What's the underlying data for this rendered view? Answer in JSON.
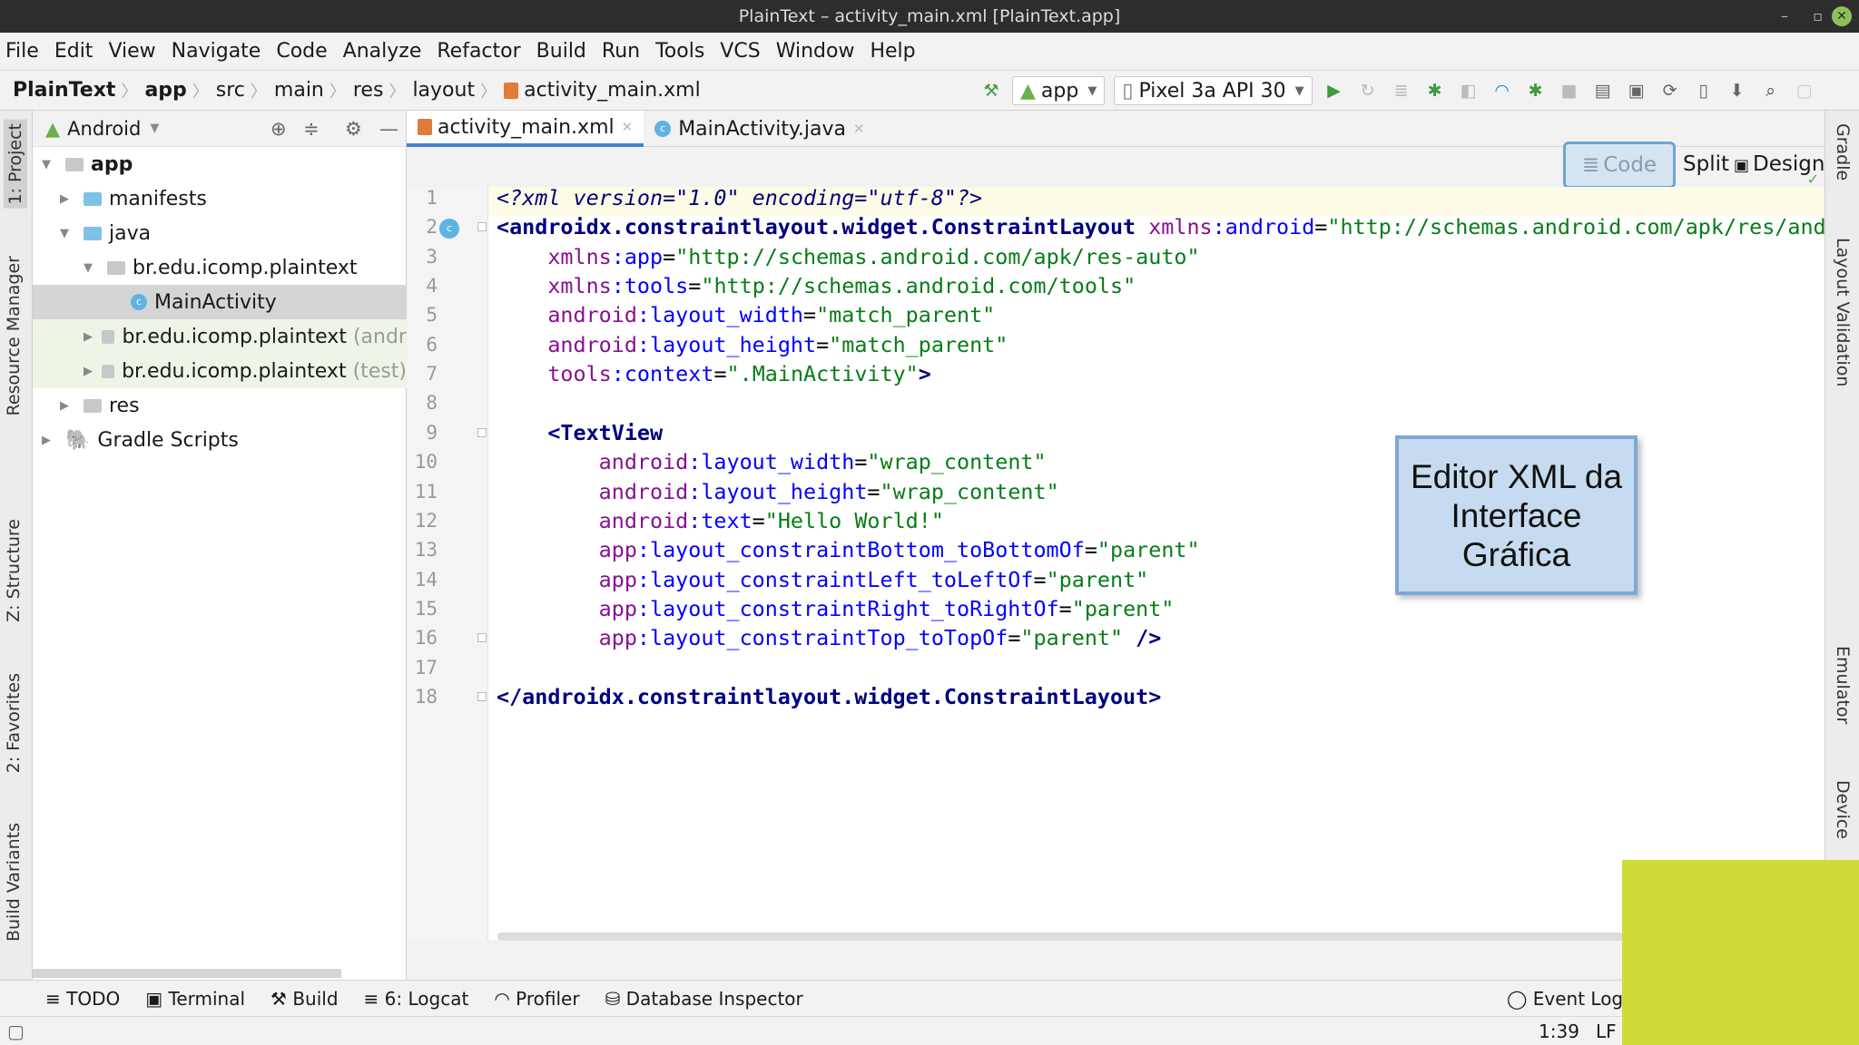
{
  "window": {
    "title": "PlainText – activity_main.xml [PlainText.app]",
    "minimize": "–",
    "maximize": "▫",
    "close": "✕"
  },
  "menu": [
    "File",
    "Edit",
    "View",
    "Navigate",
    "Code",
    "Analyze",
    "Refactor",
    "Build",
    "Run",
    "Tools",
    "VCS",
    "Window",
    "Help"
  ],
  "breadcrumb": [
    "PlainText",
    "app",
    "src",
    "main",
    "res",
    "layout",
    "activity_main.xml"
  ],
  "toolbar": {
    "run_config": "app",
    "device": "Pixel 3a API 30"
  },
  "left_stripe": [
    "1: Project",
    "Resource Manager",
    "Z: Structure",
    "2: Favorites",
    "Build Variants"
  ],
  "project": {
    "view_mode": "Android",
    "tree": [
      {
        "label": "app"
      },
      {
        "label": "manifests"
      },
      {
        "label": "java"
      },
      {
        "label": "br.edu.icomp.plaintext"
      },
      {
        "label": "MainActivity"
      },
      {
        "label": "br.edu.icomp.plaintext",
        "suffix": "(andr"
      },
      {
        "label": "br.edu.icomp.plaintext",
        "suffix": "(test)"
      },
      {
        "label": "res"
      },
      {
        "label": "Gradle Scripts"
      }
    ]
  },
  "tabs": [
    {
      "label": "activity_main.xml"
    },
    {
      "label": "MainActivity.java"
    }
  ],
  "view_modes": {
    "code": "Code",
    "split": "Split",
    "design": "Design"
  },
  "code_lines": [
    [
      [
        "pi",
        "<?xml version=\"1.0\" encoding=\"utf-8\"?>"
      ]
    ],
    [
      [
        "tag",
        "<androidx.constraintlayout.widget.ConstraintLayout "
      ],
      [
        "ns",
        "xmlns"
      ],
      [
        "attr",
        ":android"
      ],
      [
        "pun",
        "="
      ],
      [
        "val",
        "\"http://schemas.android.com/apk/res/and"
      ]
    ],
    [
      [
        "pun",
        "    "
      ],
      [
        "ns",
        "xmlns"
      ],
      [
        "attr",
        ":app"
      ],
      [
        "pun",
        "="
      ],
      [
        "val",
        "\"http://schemas.android.com/apk/res-auto\""
      ]
    ],
    [
      [
        "pun",
        "    "
      ],
      [
        "ns",
        "xmlns"
      ],
      [
        "attr",
        ":tools"
      ],
      [
        "pun",
        "="
      ],
      [
        "val",
        "\"http://schemas.android.com/tools\""
      ]
    ],
    [
      [
        "pun",
        "    "
      ],
      [
        "ns",
        "android"
      ],
      [
        "attr",
        ":layout_width"
      ],
      [
        "pun",
        "="
      ],
      [
        "val",
        "\"match_parent\""
      ]
    ],
    [
      [
        "pun",
        "    "
      ],
      [
        "ns",
        "android"
      ],
      [
        "attr",
        ":layout_height"
      ],
      [
        "pun",
        "="
      ],
      [
        "val",
        "\"match_parent\""
      ]
    ],
    [
      [
        "pun",
        "    "
      ],
      [
        "ns",
        "tools"
      ],
      [
        "attr",
        ":context"
      ],
      [
        "pun",
        "="
      ],
      [
        "val",
        "\".MainActivity\""
      ],
      [
        "tag",
        ">"
      ]
    ],
    [],
    [
      [
        "pun",
        "    "
      ],
      [
        "tag",
        "<TextView"
      ]
    ],
    [
      [
        "pun",
        "        "
      ],
      [
        "ns",
        "android"
      ],
      [
        "attr",
        ":layout_width"
      ],
      [
        "pun",
        "="
      ],
      [
        "val",
        "\"wrap_content\""
      ]
    ],
    [
      [
        "pun",
        "        "
      ],
      [
        "ns",
        "android"
      ],
      [
        "attr",
        ":layout_height"
      ],
      [
        "pun",
        "="
      ],
      [
        "val",
        "\"wrap_content\""
      ]
    ],
    [
      [
        "pun",
        "        "
      ],
      [
        "ns",
        "android"
      ],
      [
        "attr",
        ":text"
      ],
      [
        "pun",
        "="
      ],
      [
        "val",
        "\"Hello World!\""
      ]
    ],
    [
      [
        "pun",
        "        "
      ],
      [
        "ns",
        "app"
      ],
      [
        "attr",
        ":layout_constraintBottom_toBottomOf"
      ],
      [
        "pun",
        "="
      ],
      [
        "val",
        "\"parent\""
      ]
    ],
    [
      [
        "pun",
        "        "
      ],
      [
        "ns",
        "app"
      ],
      [
        "attr",
        ":layout_constraintLeft_toLeftOf"
      ],
      [
        "pun",
        "="
      ],
      [
        "val",
        "\"parent\""
      ]
    ],
    [
      [
        "pun",
        "        "
      ],
      [
        "ns",
        "app"
      ],
      [
        "attr",
        ":layout_constraintRight_toRightOf"
      ],
      [
        "pun",
        "="
      ],
      [
        "val",
        "\"parent\""
      ]
    ],
    [
      [
        "pun",
        "        "
      ],
      [
        "ns",
        "app"
      ],
      [
        "attr",
        ":layout_constraintTop_toTopOf"
      ],
      [
        "pun",
        "="
      ],
      [
        "val",
        "\"parent\""
      ],
      [
        "tag",
        " />"
      ]
    ],
    [],
    [
      [
        "tag",
        "</androidx.constraintlayout.widget.ConstraintLayout>"
      ]
    ]
  ],
  "right_stripe": [
    "Gradle",
    "Layout Validation",
    "Emulator",
    "Device"
  ],
  "bottom_tools": [
    "TODO",
    "Terminal",
    "Build",
    "6: Logcat",
    "Profiler",
    "Database Inspector"
  ],
  "event_log": "Event Log",
  "status": {
    "position": "1:39",
    "line_sep": "LF"
  },
  "callout": "Editor XML da Interface Gráfica",
  "colors": {
    "accent": "#4083c9",
    "highlight_block": "#cddc39",
    "callout_bg": "#c6dbef"
  }
}
